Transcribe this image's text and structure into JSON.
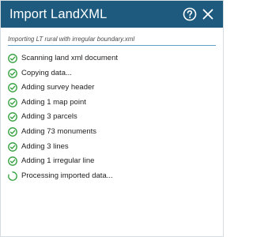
{
  "dialog": {
    "title": "Import LandXML",
    "help_icon": "help-circle-icon",
    "close_icon": "close-icon"
  },
  "file_line": "Importing LT rural with irregular boundary.xml",
  "steps": [
    {
      "label": "Scanning land xml document",
      "status": "done"
    },
    {
      "label": "Copying data...",
      "status": "done"
    },
    {
      "label": "Adding survey header",
      "status": "done"
    },
    {
      "label": "Adding 1 map point",
      "status": "done"
    },
    {
      "label": "Adding 3 parcels",
      "status": "done"
    },
    {
      "label": "Adding 73 monuments",
      "status": "done"
    },
    {
      "label": "Adding 3 lines",
      "status": "done"
    },
    {
      "label": "Adding 1 irregular line",
      "status": "done"
    },
    {
      "label": "Processing imported data...",
      "status": "in-progress"
    }
  ],
  "colors": {
    "titlebar": "#1e5a7e",
    "success": "#2e9e3a",
    "underline": "#5fa0c9"
  }
}
